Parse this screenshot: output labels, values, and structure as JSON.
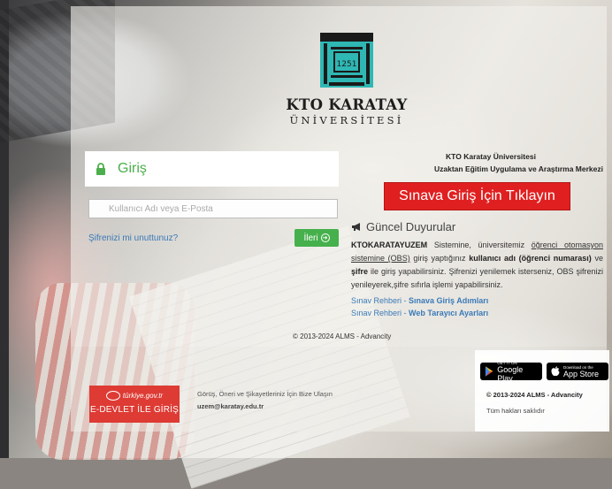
{
  "branding": {
    "logo_badge_text": "1251",
    "name": "KTO KARATAY",
    "subtitle": "ÜNİVERSİTESİ"
  },
  "login": {
    "title": "Giriş",
    "username_placeholder": "Kullanıcı Adı veya E-Posta",
    "username_value": "",
    "forgot_label": "Şifrenizi mi unuttunuz?",
    "next_label": "İleri"
  },
  "info": {
    "university": "KTO Karatay Üniversitesi",
    "center": "Uzaktan Eğitim Uygulama ve Araştırma Merkezi",
    "exam_button": "Sınava Giriş İçin Tıklayın"
  },
  "announcements": {
    "title": "Güncel Duyurular",
    "p1_b1": "KTOKARATAYUZEM",
    "p1_t1": " Sistemine, üniversitemiz ",
    "p1_u1": "öğrenci otomasyon sistemine (OBS)",
    "p1_t2": " giriş yaptığınız ",
    "p1_b2": "kullanıcı adı (öğrenci numarası)",
    "p1_t3": " ve ",
    "p1_b3": "şifre",
    "p1_t4": " ile giriş yapabilirsiniz. Şifrenizi yenilemek isterseniz, OBS şifrenizi yenileyerek,şifre sıfırla işlemi yapabilirsiniz.",
    "guide1_prefix": "Sınav Rehberi - ",
    "guide1_link": "Sınava Giriş Adımları",
    "guide2_prefix": "Sınav Rehberi - ",
    "guide2_link": "Web Tarayıcı Ayarları"
  },
  "copyright_mid": "© 2013-2024 ALMS - Advancity",
  "footer": {
    "edevlet_top": "türkiye.gov.tr",
    "edevlet_label": "E-DEVLET İLE GİRİŞ",
    "contact_line": "Görüş, Öneri ve Şikayetleriniz İçin Bize Ulaşın",
    "contact_email": "uzem@karatay.edu.tr",
    "google_small": "GET IT ON",
    "google_big": "Google Play",
    "apple_small": "Download on the",
    "apple_big": "App Store",
    "copyright": "© 2013-2024 ALMS - Advancity",
    "rights": "Tüm hakları saklıdır"
  },
  "colors": {
    "brand_green": "#46b04c",
    "exam_red": "#e02020",
    "logo_teal": "#2fb7b4",
    "link_blue": "#3a7ab8"
  }
}
